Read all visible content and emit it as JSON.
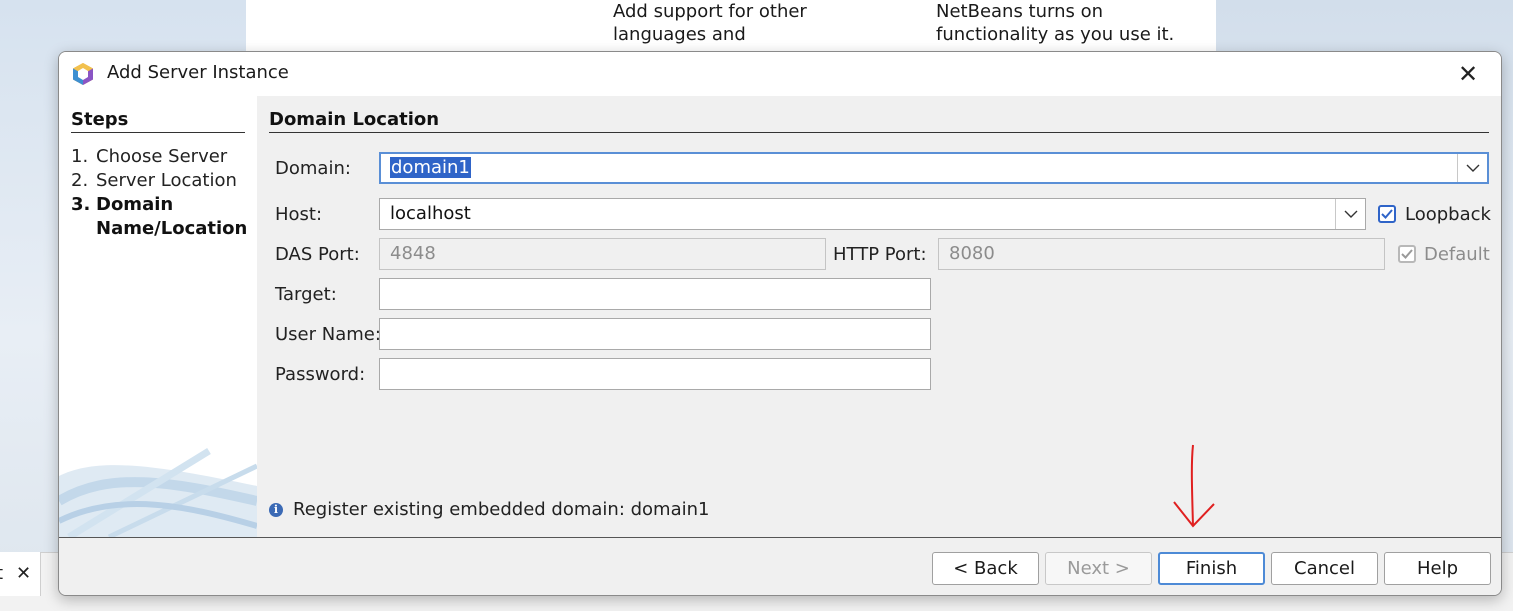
{
  "background": {
    "text_left_line1": "Add support for other",
    "text_left_line2": "languages and",
    "text_right_line1": "NetBeans turns on",
    "text_right_line2": "functionality as you use it.",
    "tab_fragment": "t"
  },
  "dialog": {
    "title": "Add Server Instance",
    "app_icon": "netbeans-cube-icon",
    "close_glyph": "✕"
  },
  "steps": {
    "title": "Steps",
    "items": [
      {
        "num": "1.",
        "label": "Choose Server",
        "current": false
      },
      {
        "num": "2.",
        "label": "Server Location",
        "current": false
      },
      {
        "num": "3.",
        "label": "Domain",
        "current": true
      }
    ],
    "current_label_cont": "Name/Location"
  },
  "form": {
    "section_title": "Domain Location",
    "domain_label": "Domain:",
    "domain_value": "domain1",
    "host_label": "Host:",
    "host_value": "localhost",
    "loopback_label": "Loopback",
    "loopback_checked": true,
    "das_port_label": "DAS Port:",
    "das_port_value": "4848",
    "http_port_label": "HTTP Port:",
    "http_port_value": "8080",
    "default_label": "Default",
    "default_checked": true,
    "target_label": "Target:",
    "target_value": "",
    "username_label": "User Name:",
    "username_value": "",
    "password_label": "Password:",
    "password_value": ""
  },
  "info_message": "Register existing embedded domain: domain1",
  "buttons": {
    "back": "< Back",
    "next": "Next >",
    "finish": "Finish",
    "cancel": "Cancel",
    "help": "Help"
  },
  "colors": {
    "accent": "#2f64c8",
    "focus_border": "#5a8fd6",
    "annotation_arrow": "#e02020"
  }
}
